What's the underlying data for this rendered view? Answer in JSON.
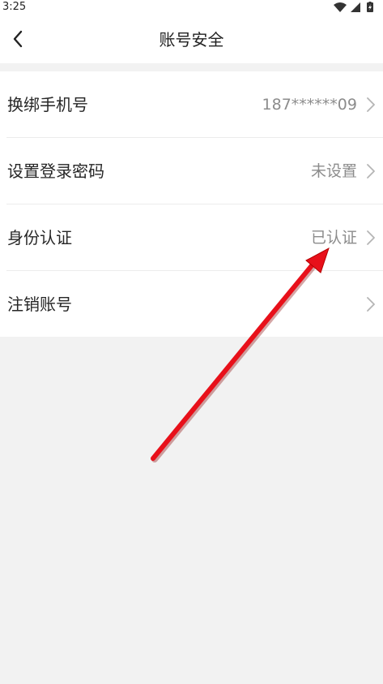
{
  "status_bar": {
    "time": "3:25",
    "icons": [
      "wifi-icon",
      "signal-icon",
      "battery-icon"
    ]
  },
  "header": {
    "title": "账号安全",
    "back_icon": "chevron-left-icon"
  },
  "settings": {
    "items": [
      {
        "label": "换绑手机号",
        "value": "187******09"
      },
      {
        "label": "设置登录密码",
        "value": "未设置"
      },
      {
        "label": "身份认证",
        "value": "已认证"
      },
      {
        "label": "注销账号",
        "value": ""
      }
    ]
  },
  "annotation": {
    "arrow_color": "#e8101a",
    "points_to": "已认证"
  },
  "colors": {
    "background": "#f2f2f2",
    "card": "#ffffff",
    "value_text": "#8c8c8c"
  }
}
